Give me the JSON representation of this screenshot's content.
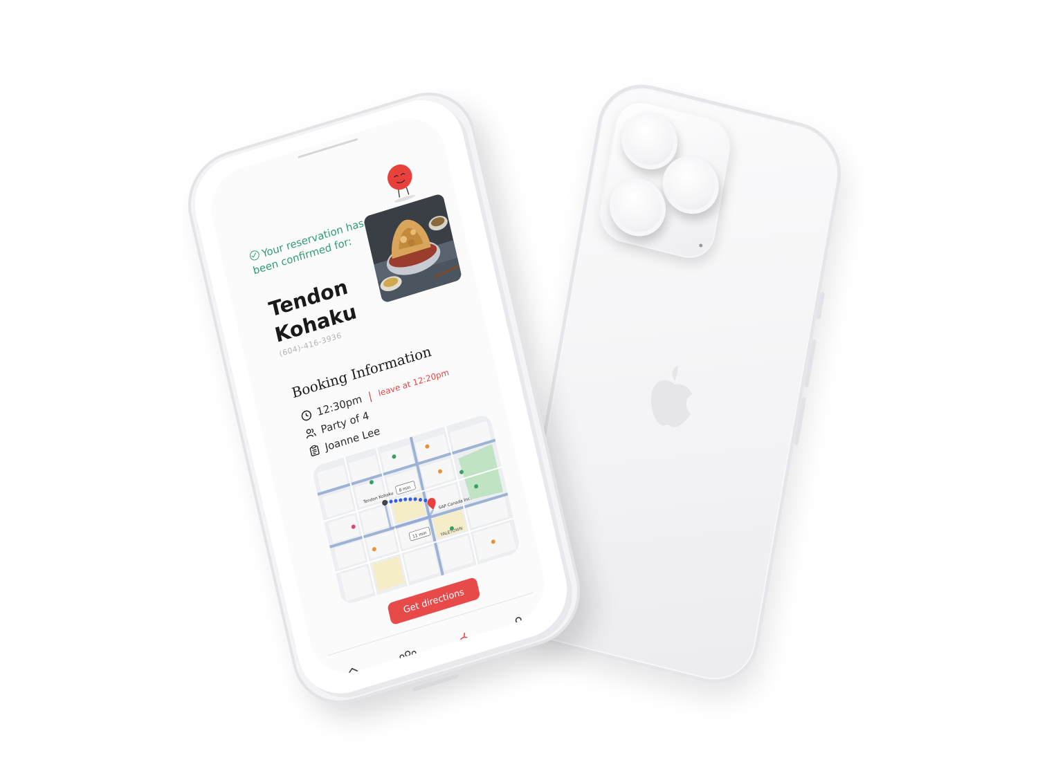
{
  "reservation": {
    "confirm_message": "Your reservation has been confirmed for:",
    "restaurant_name": "Tendon Kohaku",
    "restaurant_phone": "(604)-416-3936"
  },
  "booking": {
    "heading": "Booking Information",
    "time": "12:30pm",
    "separator": "|",
    "leave_note": "leave at 12:20pm",
    "party": "Party of 4",
    "guest_name": "Joanne Lee"
  },
  "map": {
    "labels": {
      "restaurant_pin": "Tendon Kohaku",
      "destination_pin": "SAP Canada Inc.",
      "walk_time_1": "8 min",
      "walk_time_2": "11 min",
      "district": "YALETOWN"
    }
  },
  "actions": {
    "directions_label": "Get directions"
  },
  "nav": {
    "items": [
      {
        "icon": "home-icon"
      },
      {
        "icon": "group-icon"
      },
      {
        "icon": "food-icon",
        "active": true
      },
      {
        "icon": "profile-icon"
      }
    ]
  },
  "colors": {
    "accent": "#e84a4a",
    "confirm_green": "#2e9e6e",
    "text_dark": "#1a1a1a",
    "muted": "#b3b3b3"
  }
}
